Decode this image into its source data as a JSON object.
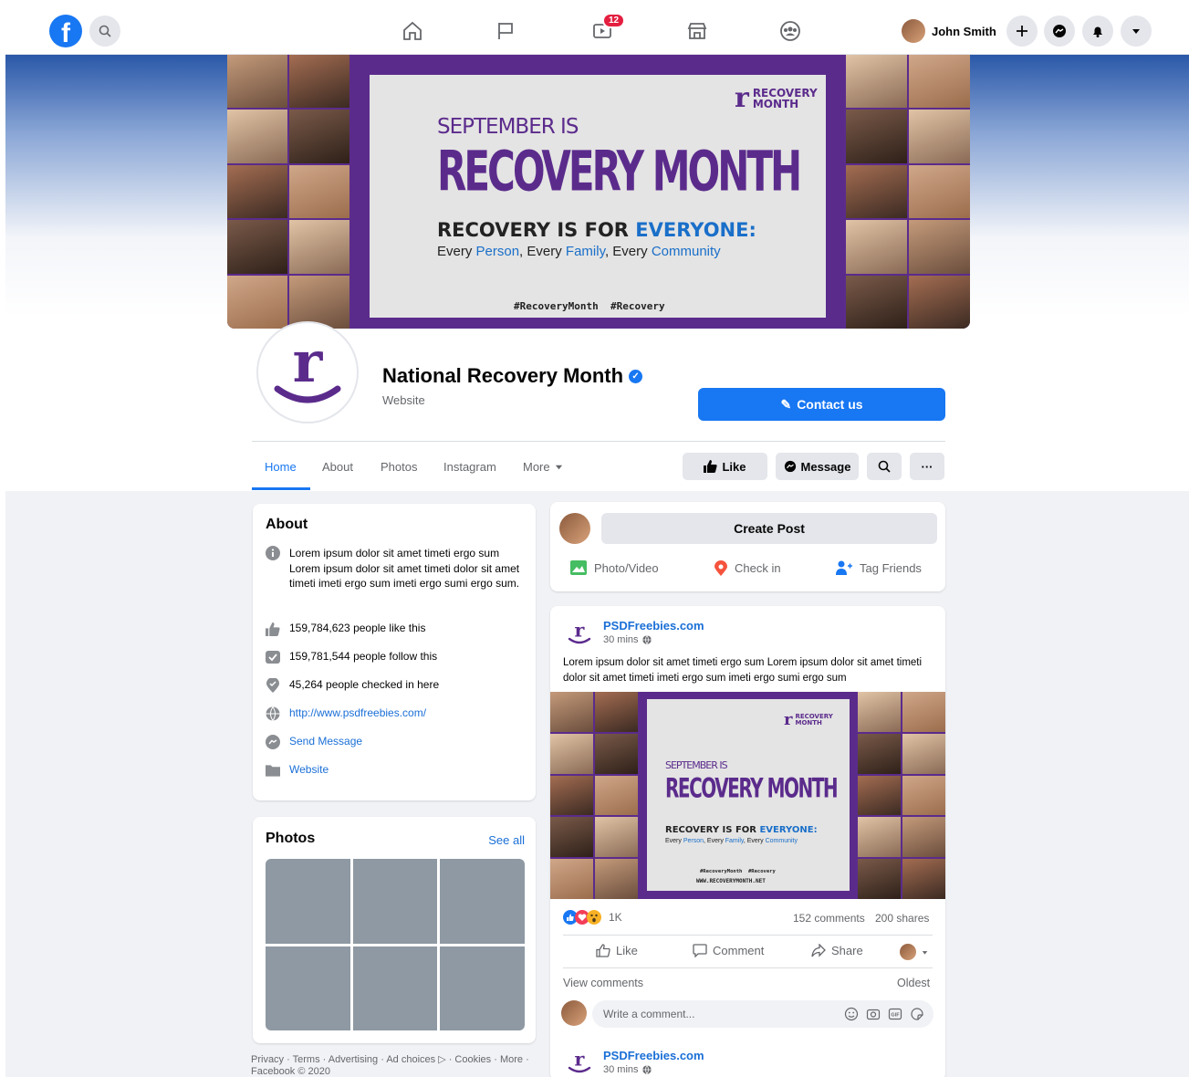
{
  "topbar": {
    "user_name": "John Smith",
    "watch_badge": "12"
  },
  "cover": {
    "pre_title": "SEPTEMBER IS",
    "title": "RECOVERY MONTH",
    "tagline_a": "RECOVERY IS FOR ",
    "tagline_b": "EVERYONE:",
    "sub_every1": "Every ",
    "sub_person": "Person",
    "sub_every2": ", Every ",
    "sub_family": "Family",
    "sub_every3": ", Every ",
    "sub_community": "Community",
    "hashtags": "#RecoveryMonth  #Recovery",
    "logo_line1": "RECOVERY",
    "logo_line2": "MONTH",
    "website": "WWW.RECOVERYMONTH.NET"
  },
  "page": {
    "name": "National Recovery Month",
    "category": "Website",
    "contact_label": "Contact us"
  },
  "tabs": [
    "Home",
    "About",
    "Photos",
    "Instagram",
    "More"
  ],
  "page_actions": {
    "like": "Like",
    "message": "Message"
  },
  "about": {
    "title": "About",
    "description": "Lorem ipsum dolor sit amet timeti ergo sum Lorem ipsum dolor sit amet timeti dolor sit amet timeti imeti ergo sum imeti ergo sumi ergo sum.",
    "likes": "159,784,623 people like this",
    "follows": "159,781,544 people follow this",
    "checkins": "45,264 people checked in here",
    "url": "http://www.psdfreebies.com/",
    "send_message": "Send Message",
    "website": "Website"
  },
  "photos": {
    "title": "Photos",
    "see_all": "See all"
  },
  "footer": "Privacy · Terms · Advertising · Ad choices ▷ · Cookies · More · Facebook © 2020",
  "create_post": {
    "label": "Create Post",
    "photo_video": "Photo/Video",
    "check_in": "Check in",
    "tag_friends": "Tag Friends"
  },
  "post": {
    "author": "PSDFreebies.com",
    "time": "30 mins",
    "text": "Lorem ipsum dolor sit amet timeti ergo sum Lorem ipsum dolor sit amet timeti dolor sit amet timeti imeti ergo sum imeti ergo sumi ergo sum",
    "reaction_count": "1K",
    "comments": "152 comments",
    "shares": "200 shares",
    "like": "Like",
    "comment": "Comment",
    "share": "Share",
    "view_comments": "View comments",
    "sort": "Oldest",
    "comment_placeholder": "Write a comment..."
  },
  "post2": {
    "author": "PSDFreebies.com",
    "time": "30 mins"
  },
  "colors": {
    "brand": "#1877f2",
    "purple": "#5b2b8c",
    "link": "#1a6fd6"
  }
}
